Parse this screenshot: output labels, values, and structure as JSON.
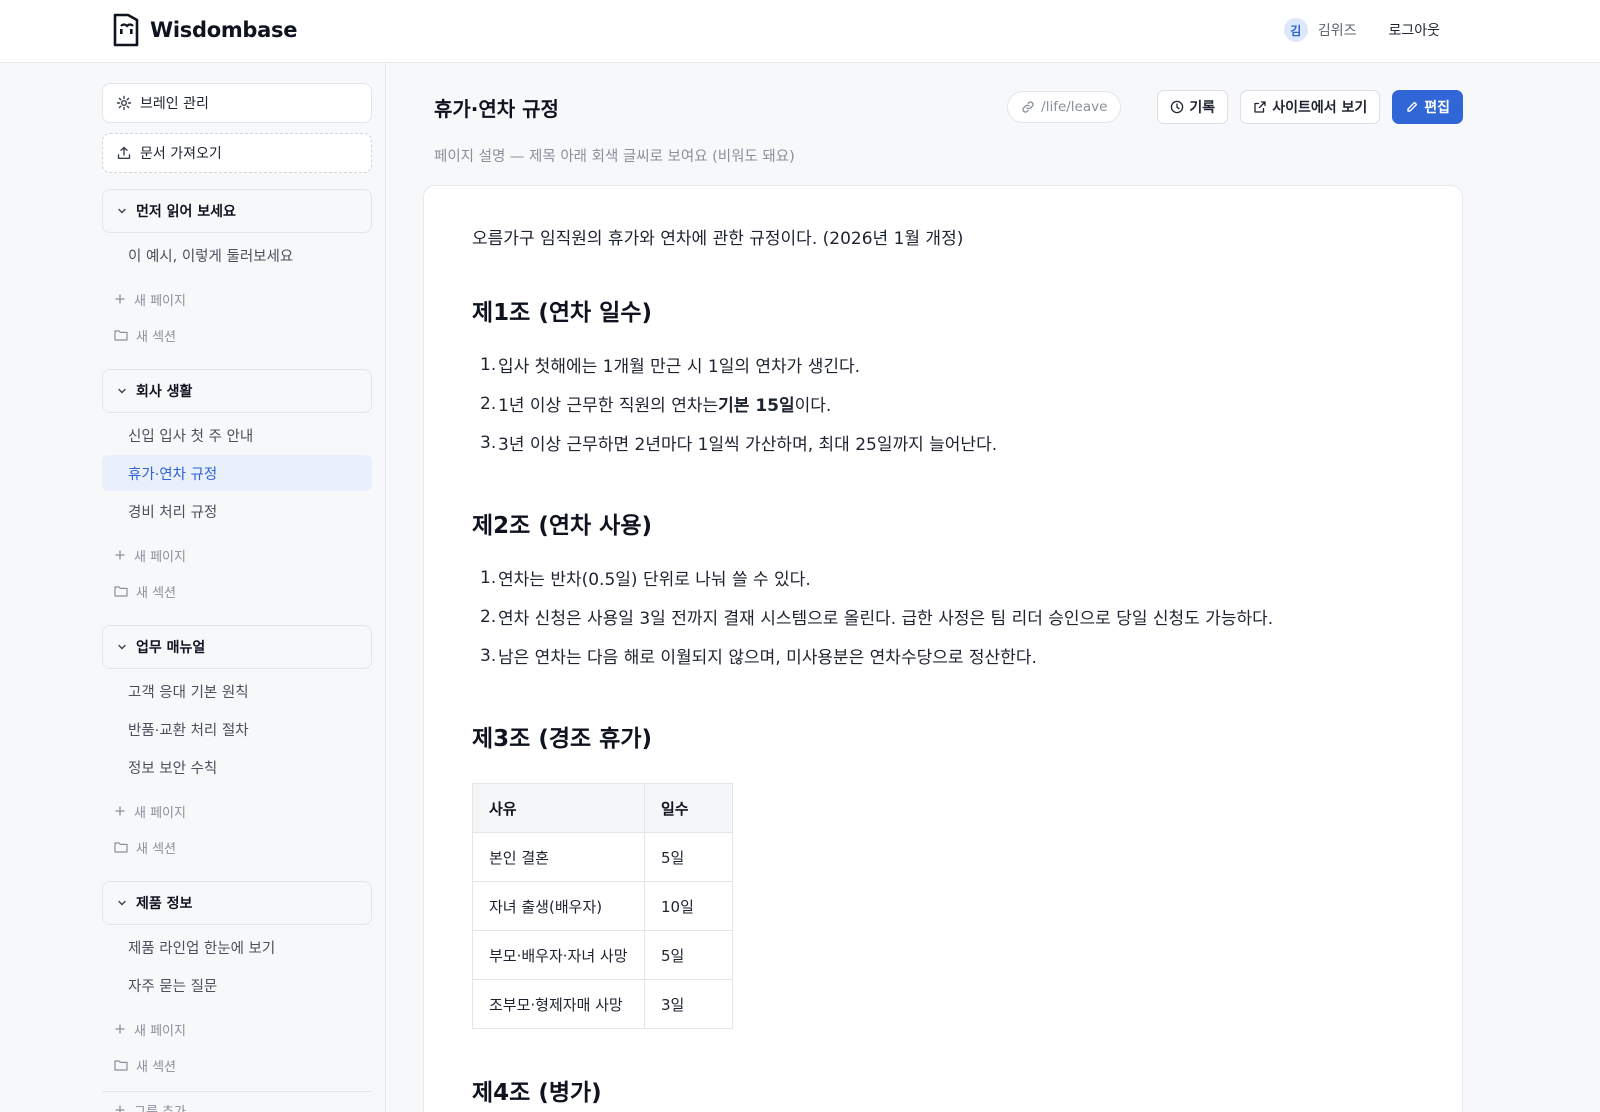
{
  "app": {
    "name": "Wisdombase"
  },
  "user": {
    "avatar_initial": "김",
    "name": "김위즈",
    "logout_label": "로그아웃"
  },
  "sidebar": {
    "brain_manage_label": "브레인 관리",
    "import_label": "문서 가져오기",
    "add_page_label": "새 페이지",
    "add_section_label": "새 섹션",
    "add_group_label": "그룹 추가",
    "groups": [
      {
        "title": "먼저 읽어 보세요",
        "pages": [
          {
            "label": "이 예시, 이렇게 둘러보세요"
          }
        ]
      },
      {
        "title": "회사 생활",
        "pages": [
          {
            "label": "신입 입사 첫 주 안내"
          },
          {
            "label": "휴가·연차 규정",
            "active": true
          },
          {
            "label": "경비 처리 규정"
          }
        ]
      },
      {
        "title": "업무 매뉴얼",
        "pages": [
          {
            "label": "고객 응대 기본 원칙"
          },
          {
            "label": "반품·교환 처리 절차"
          },
          {
            "label": "정보 보안 수칙"
          }
        ]
      },
      {
        "title": "제품 정보",
        "pages": [
          {
            "label": "제품 라인업 한눈에 보기"
          },
          {
            "label": "자주 묻는 질문"
          }
        ]
      }
    ]
  },
  "page": {
    "title": "휴가·연차 규정",
    "slug": "/life/leave",
    "history_label": "기록",
    "view_site_label": "사이트에서 보기",
    "edit_label": "편집",
    "description": "페이지 설명 — 제목 아래 회색 글씨로 보여요 (비워도 돼요)"
  },
  "article": {
    "intro": "오름가구 임직원의 휴가와 연차에 관한 규정이다. (2026년 1월 개정)",
    "s1": {
      "heading": "제1조 (연차 일수)",
      "item1": "입사 첫해에는 1개월 만근 시 1일의 연차가 생긴다.",
      "item2_pre": "1년 이상 근무한 직원의 연차는 ",
      "item2_bold": "기본 15일",
      "item2_post": "이다.",
      "item3": "3년 이상 근무하면 2년마다 1일씩 가산하며, 최대 25일까지 늘어난다."
    },
    "s2": {
      "heading": "제2조 (연차 사용)",
      "item1": "연차는 반차(0.5일) 단위로 나눠 쓸 수 있다.",
      "item2": "연차 신청은 사용일 3일 전까지 결재 시스템으로 올린다. 급한 사정은 팀 리더 승인으로 당일 신청도 가능하다.",
      "item3": "남은 연차는 다음 해로 이월되지 않으며, 미사용분은 연차수당으로 정산한다."
    },
    "s3": {
      "heading": "제3조 (경조 휴가)",
      "table": {
        "headers": [
          "사유",
          "일수"
        ],
        "rows": [
          [
            "본인 결혼",
            "5일"
          ],
          [
            "자녀 출생(배우자)",
            "10일"
          ],
          [
            "부모·배우자·자녀 사망",
            "5일"
          ],
          [
            "조부모·형제자매 사망",
            "3일"
          ]
        ]
      }
    },
    "s4": {
      "heading": "제4조 (병가)"
    }
  },
  "colors": {
    "accent": "#3166d6",
    "active_bg": "#eaf0fb",
    "sidebar_bg": "#f7f8fa"
  }
}
